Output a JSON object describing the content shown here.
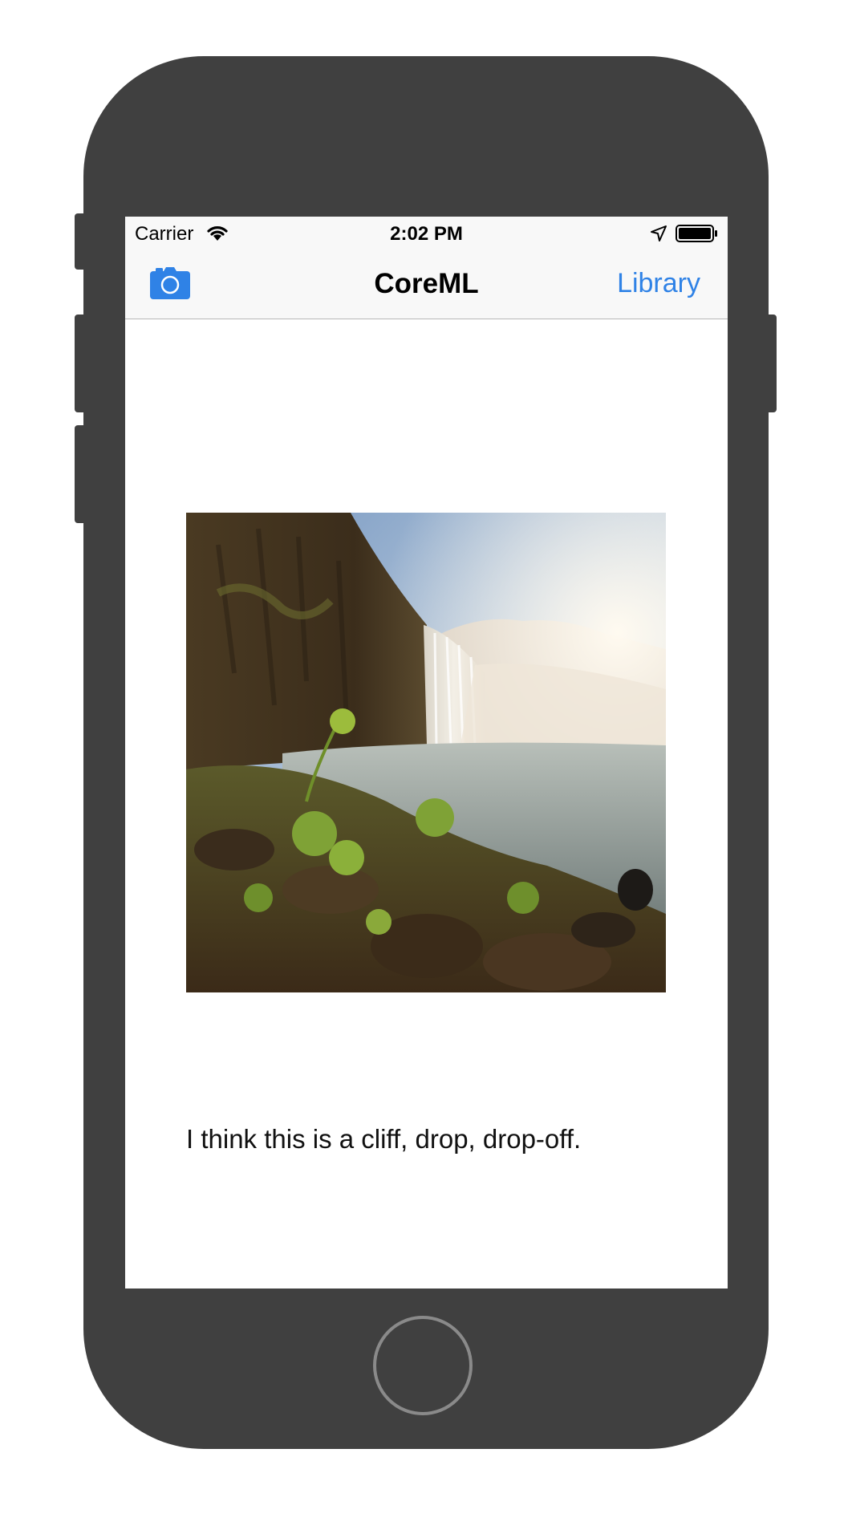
{
  "status_bar": {
    "carrier": "Carrier",
    "time": "2:02 PM",
    "wifi_icon": "wifi-icon",
    "location_icon": "location-arrow-icon",
    "battery_icon": "battery-icon"
  },
  "nav_bar": {
    "title": "CoreML",
    "camera_icon": "camera-icon",
    "library_label": "Library",
    "accent_color": "#2f82e6"
  },
  "content": {
    "photo_description_icon": "waterfall-photo",
    "prediction_text": "I think this is a cliff, drop, drop-off."
  },
  "device": {
    "body_color": "#404040",
    "home_button_icon": "home-button"
  }
}
